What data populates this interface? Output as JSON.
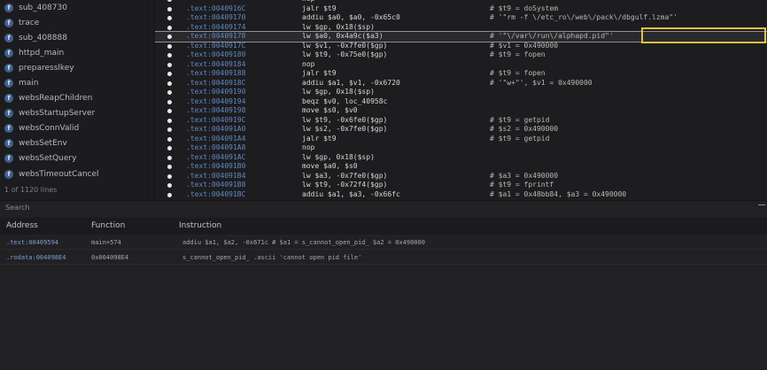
{
  "sidebar": {
    "icon_letter": "f",
    "items": [
      {
        "label": "sub_408730"
      },
      {
        "label": "trace"
      },
      {
        "label": "sub_408888"
      },
      {
        "label": "httpd_main"
      },
      {
        "label": "preparesslkey"
      },
      {
        "label": "main"
      },
      {
        "label": "websReapChildren"
      },
      {
        "label": "websStartupServer"
      },
      {
        "label": "websConnValid"
      },
      {
        "label": "websSetEnv"
      },
      {
        "label": "websSetQuery"
      },
      {
        "label": "websTimeoutCancel"
      }
    ],
    "footer": "1 of 1120 lines"
  },
  "code": {
    "lines": [
      {
        "addr": "",
        "instr": "nop",
        "comment": ""
      },
      {
        "addr": ".text:0040916C",
        "instr": "jalr $t9",
        "comment": "# $t9 = doSystem"
      },
      {
        "addr": ".text:00409170",
        "instr": "addiu $a0, $a0, -0x65c0",
        "comment": "# '\"rm -f \\/etc_ro\\/web\\/pack\\/dbgulf.lzma\"'"
      },
      {
        "addr": ".text:00409174",
        "instr": "lw $gp, 0x18($sp)",
        "comment": ""
      },
      {
        "addr": ".text:00409178",
        "instr": "lw $a0, 0x4a9c($a3)",
        "comment": "# '\"\\/var\\/run\\/alphapd.pid\"'"
      },
      {
        "addr": ".text:0040917C",
        "instr": "lw $v1, -0x7fe0($gp)",
        "comment": "# $v1 = 0x490000"
      },
      {
        "addr": ".text:00409180",
        "instr": "lw $t9, -0x75e0($gp)",
        "comment": "# $t9 = fopen"
      },
      {
        "addr": ".text:00409184",
        "instr": "nop",
        "comment": ""
      },
      {
        "addr": ".text:00409188",
        "instr": "jalr $t9",
        "comment": "# $t9 = fopen"
      },
      {
        "addr": ".text:0040918C",
        "instr": "addiu $a1, $v1, -0x6720",
        "comment": "# '\"w+\"', $v1 = 0x490000"
      },
      {
        "addr": ".text:00409190",
        "instr": "lw $gp, 0x18($sp)",
        "comment": ""
      },
      {
        "addr": ".text:00409194",
        "instr": "beqz $v0, loc_40958c",
        "comment": ""
      },
      {
        "addr": ".text:00409198",
        "instr": "move $s0, $v0",
        "comment": ""
      },
      {
        "addr": ".text:0040919C",
        "instr": "lw $t9, -0x6fe0($gp)",
        "comment": "# $t9 = getpid"
      },
      {
        "addr": ".text:004091A0",
        "instr": "lw $s2, -0x7fe0($gp)",
        "comment": "# $s2 = 0x490000"
      },
      {
        "addr": ".text:004091A4",
        "instr": "jalr $t9",
        "comment": "# $t9 = getpid"
      },
      {
        "addr": ".text:004091A8",
        "instr": "nop",
        "comment": ""
      },
      {
        "addr": ".text:004091AC",
        "instr": "lw $gp, 0x18($sp)",
        "comment": ""
      },
      {
        "addr": ".text:004091B0",
        "instr": "move $a0, $s0",
        "comment": ""
      },
      {
        "addr": ".text:004091B4",
        "instr": "lw $a3, -0x7fe0($gp)",
        "comment": "# $a3 = 0x490000"
      },
      {
        "addr": ".text:004091B8",
        "instr": "lw $t9, -0x72f4($gp)",
        "comment": "# $t9 = fprintf"
      },
      {
        "addr": ".text:004091BC",
        "instr": "addiu $a1, $a3, -0x66fc",
        "comment": "# $a1 = 0x48bb84, $a3 = 0x490000"
      }
    ]
  },
  "panel": {
    "title": "Search",
    "columns": {
      "address": "Address",
      "function": "Function",
      "instruction": "Instruction"
    },
    "rows": [
      {
        "address": ".text:00409594",
        "function": "main+574",
        "instruction": "addiu $a1, $a2, -0x671c # $a1 = s_cannot_open_pid_ $a2 = 0x490000"
      },
      {
        "address": ".rodata:004098E4",
        "function": "0x004098E4",
        "instruction": "s_cannot_open_pid_ .ascii 'cannot open pid file'"
      }
    ]
  }
}
